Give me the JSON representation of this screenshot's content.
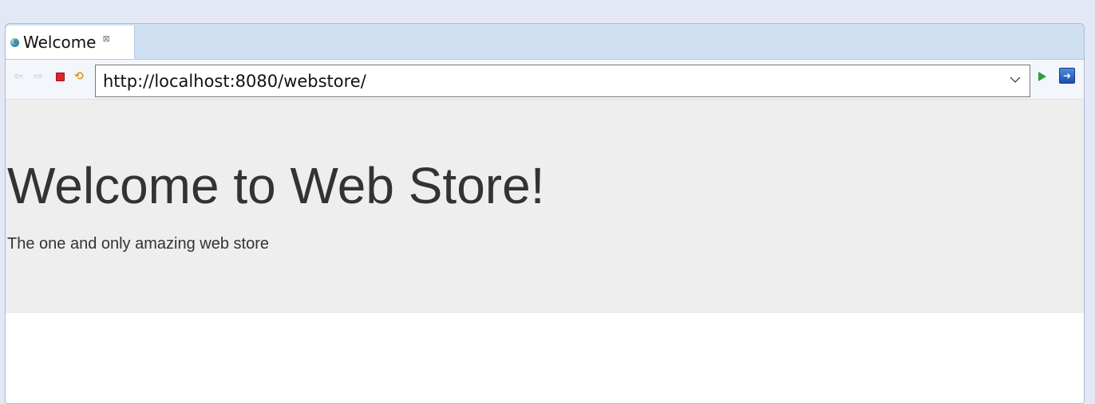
{
  "tab": {
    "label": "Welcome",
    "close_glyph": "⊠",
    "icon": "globe-icon"
  },
  "toolbar": {
    "back_icon": "back-arrow-icon",
    "back_glyph": "⇦",
    "forward_icon": "forward-arrow-icon",
    "forward_glyph": "⇨",
    "stop_icon": "stop-icon",
    "refresh_icon": "refresh-icon",
    "refresh_glyph": "⟲",
    "url": "http://localhost:8080/webstore/",
    "go_icon": "go-icon",
    "external_icon": "open-external-browser-icon",
    "external_glyph": "➜"
  },
  "page": {
    "heading": "Welcome to Web Store!",
    "tagline": "The one and only amazing web store"
  },
  "colors": {
    "tabbar": "#cddff0",
    "jumbotron": "#eeeeee",
    "text": "#333333",
    "go": "#2aa23a",
    "stop": "#e0222d"
  }
}
